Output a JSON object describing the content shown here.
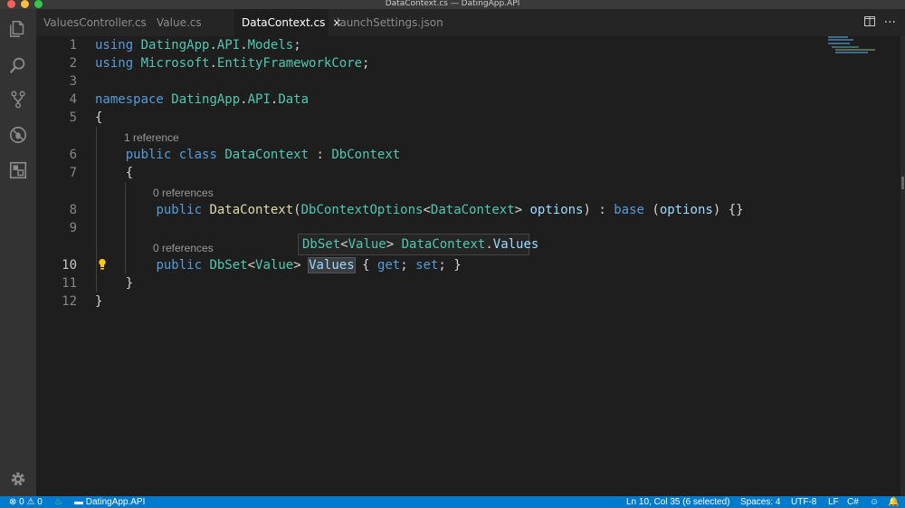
{
  "window": {
    "title": "DataContext.cs — DatingApp.API"
  },
  "tabs": [
    {
      "label": "ValuesController.cs"
    },
    {
      "label": "Value.cs"
    },
    {
      "label": "DataContext.cs",
      "close": "×"
    },
    {
      "label": "launchSettings.json"
    }
  ],
  "editor": {
    "line_numbers": [
      "1",
      "2",
      "3",
      "4",
      "5",
      "6",
      "7",
      "8",
      "9",
      "10",
      "11",
      "12"
    ],
    "codelens": [
      "1 reference",
      "0 references",
      "0 references"
    ],
    "code": {
      "l1": {
        "kw": "using",
        "ns1": "DatingApp",
        "ns2": "API",
        "ns3": "Models",
        "end": ";"
      },
      "l2": {
        "kw": "using",
        "ns1": "Microsoft",
        "ns2": "EntityFrameworkCore",
        "end": ";"
      },
      "l4": {
        "kw": "namespace",
        "ns1": "DatingApp",
        "ns2": "API",
        "ns3": "Data"
      },
      "l5": {
        "brace": "{"
      },
      "l6": {
        "kw1": "public",
        "kw2": "class",
        "name": "DataContext",
        "colon": ":",
        "base": "DbContext"
      },
      "l7": {
        "brace": "{"
      },
      "l8": {
        "kw": "public",
        "ctor": "DataContext",
        "ptype1": "DbContextOptions",
        "ptype2": "DataContext",
        "param": "options",
        "colon": ":",
        "base_kw": "base",
        "arg": "options",
        "body": "{}"
      },
      "l10": {
        "kw": "public",
        "t1": "DbSet",
        "t2": "Value",
        "prop": "Values",
        "open": "{",
        "get": "get",
        "set": "set",
        "close": "}"
      },
      "l11": {
        "brace": "}"
      },
      "l12": {
        "brace": "}"
      }
    },
    "hover": {
      "t1": "DbSet",
      "t2": "Value",
      "owner": "DataContext",
      "member": "Values"
    }
  },
  "statusbar": {
    "errors": "0",
    "warnings": "0",
    "project": "DatingApp.API",
    "cursor": "Ln 10, Col 35 (6 selected)",
    "spaces": "Spaces: 4",
    "encoding": "UTF-8",
    "eol": "LF",
    "language": "C#"
  },
  "icons": [
    "explorer-icon",
    "search-icon",
    "source-control-icon",
    "debug-icon",
    "extensions-icon",
    "settings-gear-icon",
    "split-editor-icon",
    "more-actions-icon",
    "lightbulb-icon",
    "error-icon",
    "warning-icon",
    "folder-icon",
    "smiley-icon",
    "bell-icon"
  ],
  "colors": {
    "keyword": "#569cd6",
    "type": "#4ec9b0",
    "function": "#dcdcaa",
    "parameter": "#9cdcfe",
    "statusbar": "#007acc"
  }
}
